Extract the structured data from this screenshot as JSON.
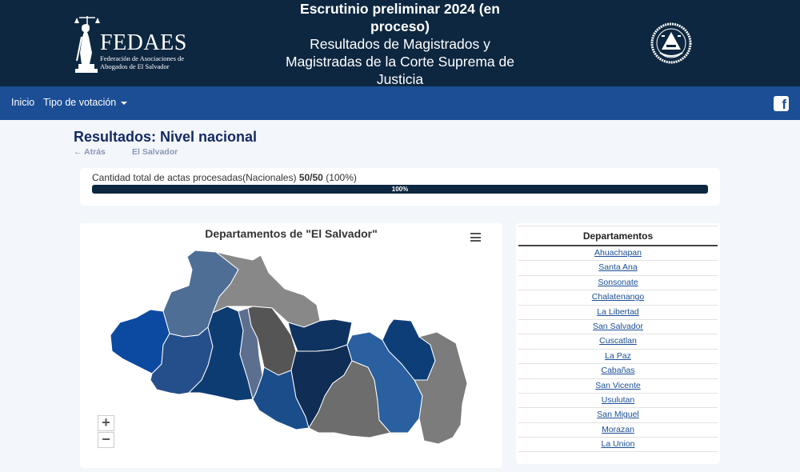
{
  "header": {
    "logo": {
      "name": "FEDAES",
      "subtitle": "Federación de Asociaciones de Abogados de El Salvador"
    },
    "title_bold": "Escrutinio preliminar 2024 (en proceso)",
    "title_regular": "Resultados de Magistrados y Magistradas de la Corte Suprema de Justicia",
    "seal_icon": "el-salvador-coat-of-arms-icon"
  },
  "nav": {
    "home": "Inicio",
    "tipo": "Tipo de votación",
    "facebook_icon": "facebook-icon"
  },
  "page": {
    "title": "Resultados: Nivel nacional",
    "back": "← Atrás",
    "crumb": "El Salvador"
  },
  "progress": {
    "label": "Cantidad total de actas procesadas(Nacionales)",
    "count": "50/50",
    "percent_text": "(100%)",
    "bar_label": "100%",
    "value": 1.0
  },
  "map": {
    "title": "Departamentos de \"El Salvador\"",
    "zoom_in": "+",
    "zoom_out": "−",
    "colors": [
      "#0b4aa0",
      "#4e6e96",
      "#888888",
      "#254f8a",
      "#0d3c72",
      "#5d6f8f",
      "#555555",
      "#0f3361",
      "#0f2d55",
      "#1a4d8a",
      "#6d6d6d",
      "#2a5fa0",
      "#0e3e78",
      "#7c7c7c"
    ]
  },
  "departamentos": {
    "header": "Departamentos",
    "items": [
      "Ahuachapan",
      "Santa Ana",
      "Sonsonate",
      "Chalatenango",
      "La Libertad",
      "San Salvador",
      "Cuscatlan",
      "La Paz",
      "Cabañas",
      "San Vicente",
      "Usulutan",
      "San Miguel",
      "Morazan",
      "La Union"
    ]
  }
}
